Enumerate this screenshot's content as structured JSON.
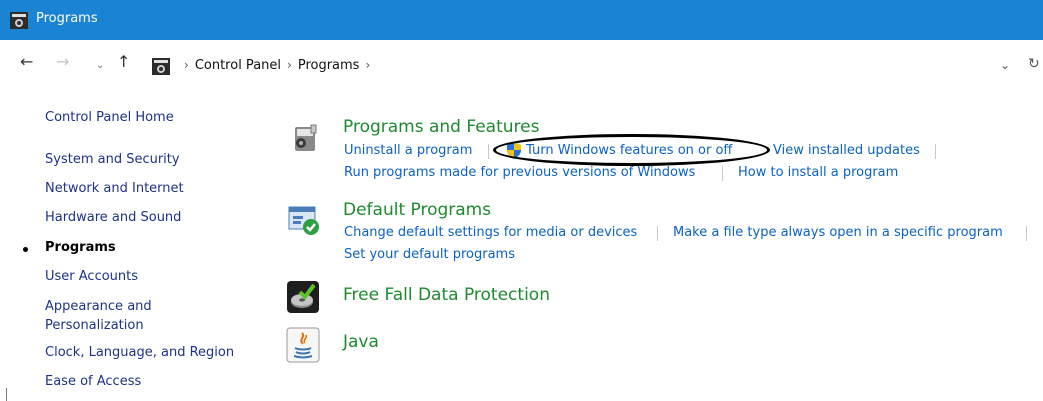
{
  "window": {
    "title": "Programs"
  },
  "address": {
    "back_glyph": "←",
    "forward_glyph": "→",
    "recent_glyph": "⌄",
    "up_glyph": "↑",
    "crumbs": [
      "Control Panel",
      "Programs"
    ],
    "separator": "›",
    "dropdown_glyph": "⌄",
    "refresh_glyph": "↻"
  },
  "sidebar": {
    "items": [
      {
        "label": "Control Panel Home"
      },
      {
        "label": "System and Security"
      },
      {
        "label": "Network and Internet"
      },
      {
        "label": "Hardware and Sound"
      },
      {
        "label": "Programs",
        "current": true
      },
      {
        "label": "User Accounts"
      },
      {
        "label": "Appearance and"
      },
      {
        "label": "Personalization"
      },
      {
        "label": "Clock, Language, and Region"
      },
      {
        "label": "Ease of Access"
      }
    ]
  },
  "categories": {
    "programs_features": {
      "title": "Programs and Features",
      "links": [
        "Uninstall a program",
        "Turn Windows features on or off",
        "View installed updates",
        "Run programs made for previous versions of Windows",
        "How to install a program"
      ]
    },
    "default_programs": {
      "title": "Default Programs",
      "links": [
        "Change default settings for media or devices",
        "Make a file type always open in a specific program",
        "Set your default programs"
      ]
    },
    "free_fall": {
      "title": "Free Fall Data Protection"
    },
    "java": {
      "title": "Java"
    }
  },
  "colors": {
    "titlebar": "#1a83d4",
    "category_title": "#1e8a2f",
    "link": "#0b62c4",
    "sidebar_link": "#1e3287"
  }
}
